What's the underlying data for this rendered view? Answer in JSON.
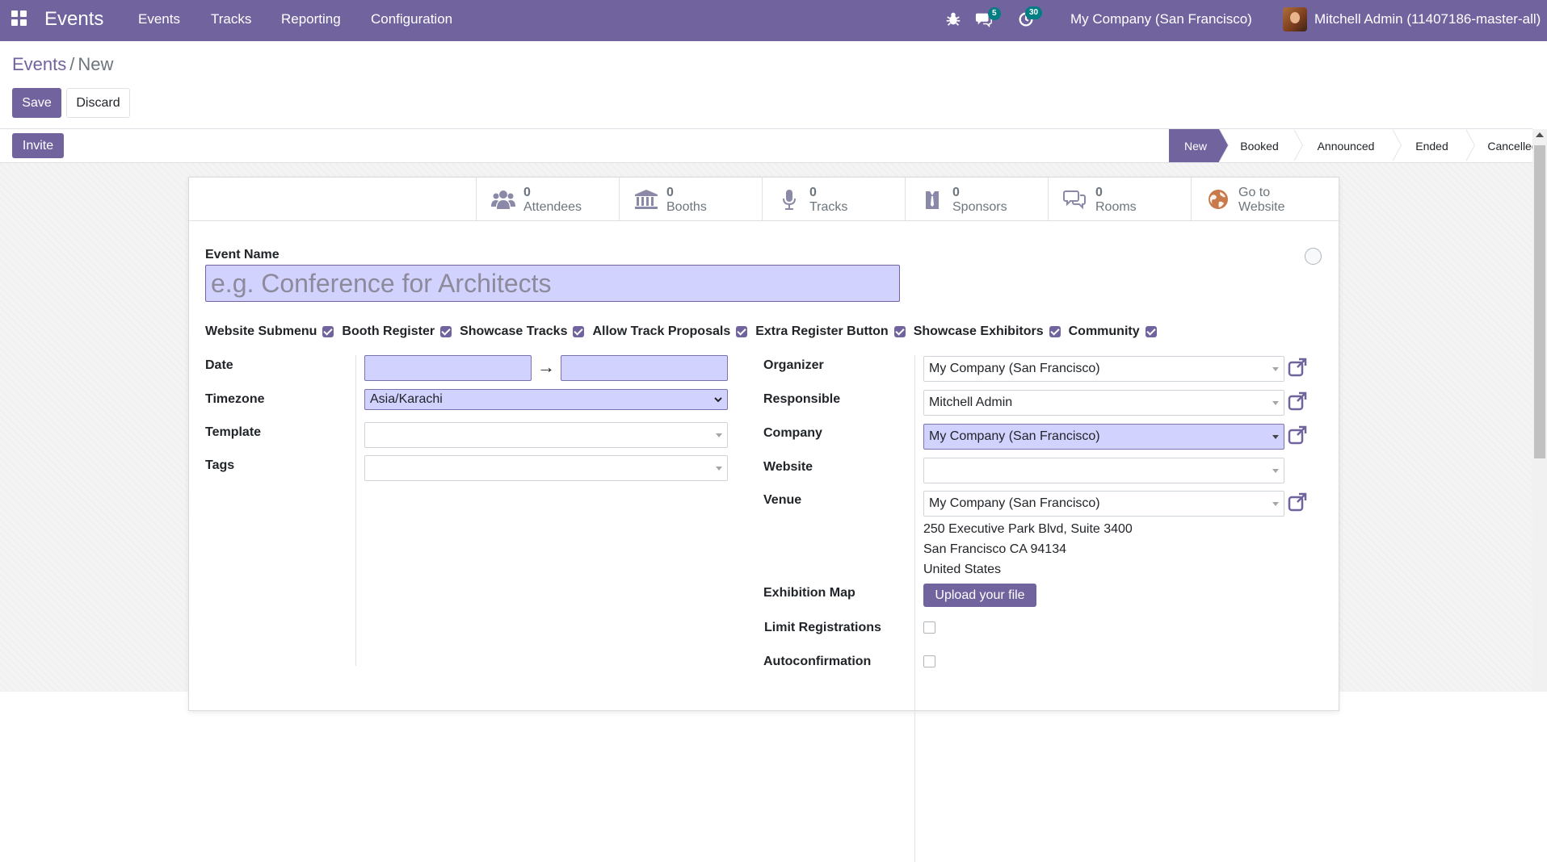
{
  "navbar": {
    "brand": "Events",
    "menu": [
      "Events",
      "Tracks",
      "Reporting",
      "Configuration"
    ],
    "messages_count": "5",
    "activities_count": "30",
    "company": "My Company (San Francisco)",
    "user": "Mitchell Admin (11407186-master-all)",
    "bg_color": "#71639e"
  },
  "breadcrumb": {
    "parent": "Events",
    "separator": "/",
    "current": "New"
  },
  "actions": {
    "save": "Save",
    "discard": "Discard",
    "invite": "Invite"
  },
  "status_steps": [
    "New",
    "Booked",
    "Announced",
    "Ended",
    "Cancelled"
  ],
  "active_status": "New",
  "smart_buttons": [
    {
      "value": "0",
      "label": "Attendees",
      "icon": "users-icon"
    },
    {
      "value": "0",
      "label": "Booths",
      "icon": "bank-icon"
    },
    {
      "value": "0",
      "label": "Tracks",
      "icon": "microphone-icon"
    },
    {
      "value": "0",
      "label": "Sponsors",
      "icon": "sponsor-icon"
    },
    {
      "value": "0",
      "label": "Rooms",
      "icon": "comments-icon"
    },
    {
      "value": "Go to",
      "label": "Website",
      "icon": "globe-icon"
    }
  ],
  "form": {
    "event_name_label": "Event Name",
    "event_name_placeholder": "e.g. Conference for Architects",
    "toggles": [
      {
        "label": "Website Submenu",
        "checked": true
      },
      {
        "label": "Booth Register",
        "checked": true
      },
      {
        "label": "Showcase Tracks",
        "checked": true
      },
      {
        "label": "Allow Track Proposals",
        "checked": true
      },
      {
        "label": "Extra Register Button",
        "checked": true
      },
      {
        "label": "Showcase Exhibitors",
        "checked": true
      },
      {
        "label": "Community",
        "checked": true
      }
    ],
    "left": {
      "date_label": "Date",
      "date_arrow": "→",
      "timezone_label": "Timezone",
      "timezone_value": "Asia/Karachi",
      "template_label": "Template",
      "tags_label": "Tags"
    },
    "right": {
      "organizer_label": "Organizer",
      "organizer_value": "My Company (San Francisco)",
      "responsible_label": "Responsible",
      "responsible_value": "Mitchell Admin",
      "company_label": "Company",
      "company_value": "My Company (San Francisco)",
      "website_label": "Website",
      "venue_label": "Venue",
      "venue_value": "My Company (San Francisco)",
      "address": [
        "250 Executive Park Blvd, Suite 3400",
        "San Francisco CA 94134",
        "United States"
      ],
      "exhibition_map_label": "Exhibition Map",
      "upload_label": "Upload your file",
      "limit_registrations_label": "Limit Registrations",
      "autoconfirmation_label": "Autoconfirmation"
    }
  }
}
